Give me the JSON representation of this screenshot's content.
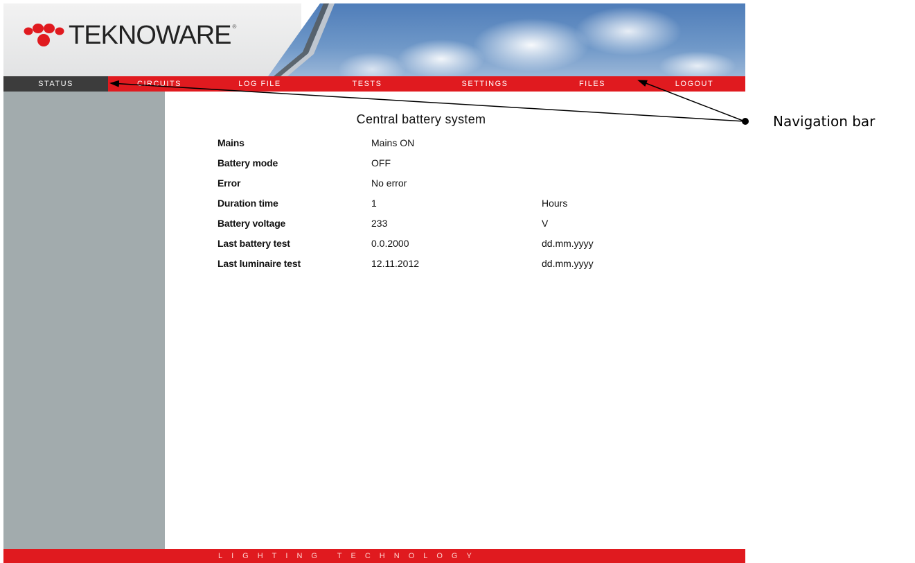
{
  "brand": {
    "name": "TEKNOWARE",
    "registered_mark": "®",
    "colors": {
      "primary_red": "#e01a1f",
      "active_tab": "#3c3c3c",
      "sidebar_gray": "#a2abad"
    }
  },
  "nav": {
    "items": [
      {
        "label": "STATUS",
        "active": true
      },
      {
        "label": "CIRCUITS",
        "active": false
      },
      {
        "label": "LOG FILE",
        "active": false
      },
      {
        "label": "TESTS",
        "active": false
      },
      {
        "label": "SETTINGS",
        "active": false
      },
      {
        "label": "FILES",
        "active": false
      },
      {
        "label": "LOGOUT",
        "active": false
      }
    ]
  },
  "main": {
    "title": "Central battery system",
    "rows": [
      {
        "label": "Mains",
        "value": "Mains ON",
        "unit": ""
      },
      {
        "label": "Battery mode",
        "value": "OFF",
        "unit": ""
      },
      {
        "label": "Error",
        "value": "No error",
        "unit": ""
      },
      {
        "label": "Duration time",
        "value": "1",
        "unit": "Hours"
      },
      {
        "label": "Battery voltage",
        "value": "233",
        "unit": "V"
      },
      {
        "label": "Last battery test",
        "value": "0.0.2000",
        "unit": "dd.mm.yyyy"
      },
      {
        "label": "Last luminaire test",
        "value": "12.11.2012",
        "unit": "dd.mm.yyyy"
      }
    ]
  },
  "footer": {
    "tagline": "LIGHTING TECHNOLOGY"
  },
  "annotation": {
    "label": "Navigation bar"
  },
  "icons": {
    "logo_mark": "teknoware-dots-logo",
    "annotation_marker": "arrow-icon"
  }
}
